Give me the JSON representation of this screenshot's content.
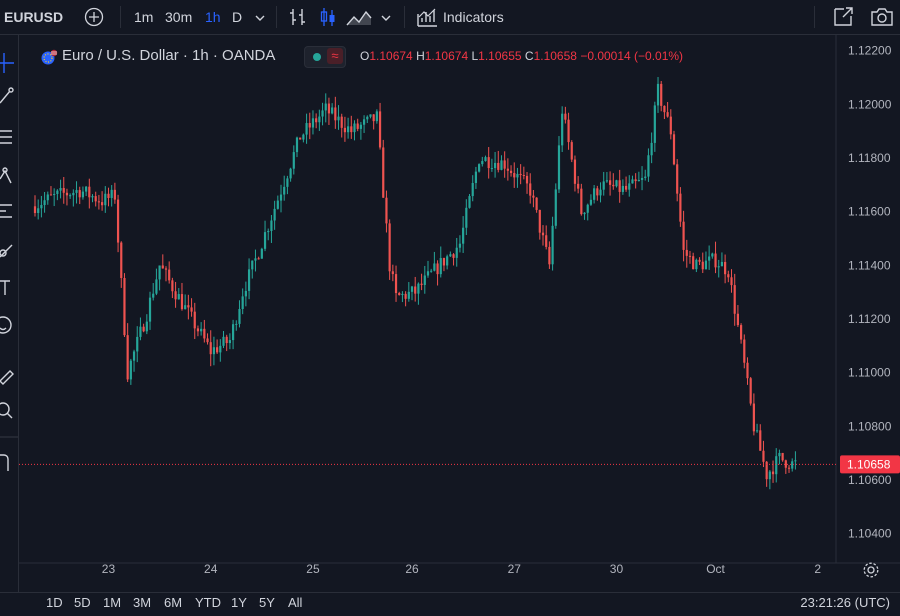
{
  "toolbar": {
    "symbol": "EURUSD",
    "intervals": [
      "1m",
      "30m",
      "1h",
      "D"
    ],
    "active_interval": "1h",
    "indicators_label": "Indicators"
  },
  "legend": {
    "title": "Euro / U.S. Dollar · 1h · OANDA",
    "o_label": "O",
    "o_value": "1.10674",
    "h_label": "H",
    "h_value": "1.10674",
    "l_label": "L",
    "l_value": "1.10655",
    "c_label": "C",
    "c_value": "1.10658",
    "change": "−0.00014 (−0.01%)",
    "pill_glyph": "≈"
  },
  "colors": {
    "up": "#26a69a",
    "down": "#ef5350",
    "background": "#131722",
    "price_tag": "#f23645",
    "accent": "#2962ff"
  },
  "bottom": {
    "ranges": [
      "1D",
      "5D",
      "1M",
      "3M",
      "6M",
      "YTD",
      "1Y",
      "5Y",
      "All"
    ],
    "clock": "23:21:26 (UTC)"
  },
  "chart_data": {
    "type": "candlestick",
    "interval": "1h",
    "x_ticks": [
      "23",
      "24",
      "25",
      "26",
      "27",
      "30",
      "Oct",
      "2"
    ],
    "y_ticks": [
      "1.12200",
      "1.12000",
      "1.11800",
      "1.11600",
      "1.11400",
      "1.11200",
      "1.11000",
      "1.10800",
      "1.10600",
      "1.10400"
    ],
    "ylim": [
      1.1032,
      1.1224
    ],
    "last_price": "1.10658",
    "waypoints": [
      [
        0,
        1.1162
      ],
      [
        8,
        1.1166
      ],
      [
        15,
        1.1168
      ],
      [
        22,
        1.1164
      ],
      [
        26,
        1.1166
      ],
      [
        30,
        1.11
      ],
      [
        36,
        1.1122
      ],
      [
        40,
        1.114
      ],
      [
        48,
        1.1124
      ],
      [
        56,
        1.1108
      ],
      [
        62,
        1.1112
      ],
      [
        66,
        1.113
      ],
      [
        70,
        1.1142
      ],
      [
        78,
        1.1168
      ],
      [
        84,
        1.1188
      ],
      [
        92,
        1.1198
      ],
      [
        100,
        1.119
      ],
      [
        108,
        1.1195
      ],
      [
        112,
        1.114
      ],
      [
        114,
        1.1128
      ],
      [
        120,
        1.113
      ],
      [
        126,
        1.1138
      ],
      [
        134,
        1.1148
      ],
      [
        140,
        1.118
      ],
      [
        148,
        1.1178
      ],
      [
        156,
        1.1168
      ],
      [
        162,
        1.114
      ],
      [
        166,
        1.1198
      ],
      [
        172,
        1.116
      ],
      [
        178,
        1.117
      ],
      [
        186,
        1.1168
      ],
      [
        192,
        1.1172
      ],
      [
        196,
        1.1205
      ],
      [
        200,
        1.119
      ],
      [
        204,
        1.1145
      ],
      [
        208,
        1.114
      ],
      [
        214,
        1.1142
      ],
      [
        218,
        1.1138
      ],
      [
        222,
        1.111
      ],
      [
        226,
        1.108
      ],
      [
        230,
        1.1062
      ],
      [
        234,
        1.1068
      ],
      [
        238,
        1.1066
      ]
    ]
  }
}
